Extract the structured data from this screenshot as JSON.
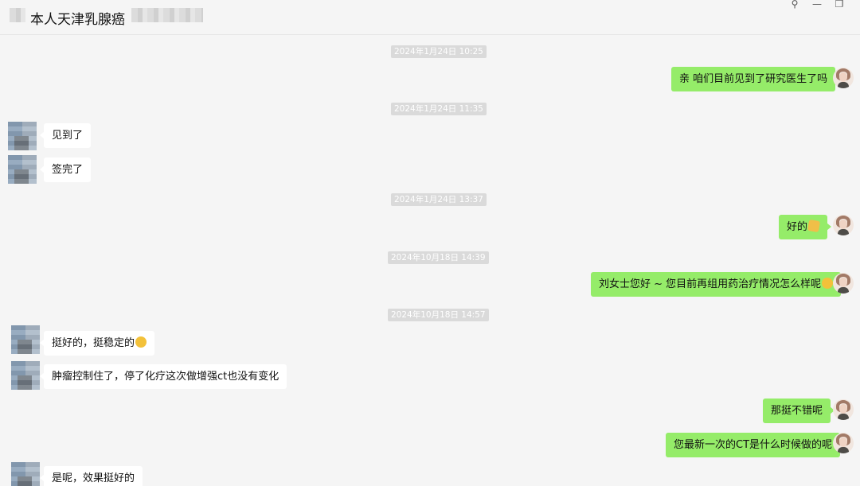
{
  "window": {
    "title": "本人天津乳腺癌",
    "pin_icon": "pin-icon",
    "minimize_icon": "minimize-icon",
    "restore_icon": "restore-icon"
  },
  "messages": {
    "t1": "2024年1月24日 10:25",
    "m1": "亲  咱们目前见到了研究医生了吗",
    "t2": "2024年1月24日 11:35",
    "m2": "见到了",
    "m3": "签完了",
    "t3": "2024年1月24日 13:37",
    "m4": "好的",
    "t4": "2024年10月18日 14:39",
    "m5": "刘女士您好 ~  您目前再组用药治疗情况怎么样呢",
    "t5": "2024年10月18日 14:57",
    "m6": "挺好的，挺稳定的",
    "m7": "肿瘤控制住了，停了化疗这次做增强ct也没有变化",
    "m8": "那挺不错呢",
    "m9": "您最新一次的CT是什么时候做的呢",
    "m10": "是呢，效果挺好的"
  }
}
